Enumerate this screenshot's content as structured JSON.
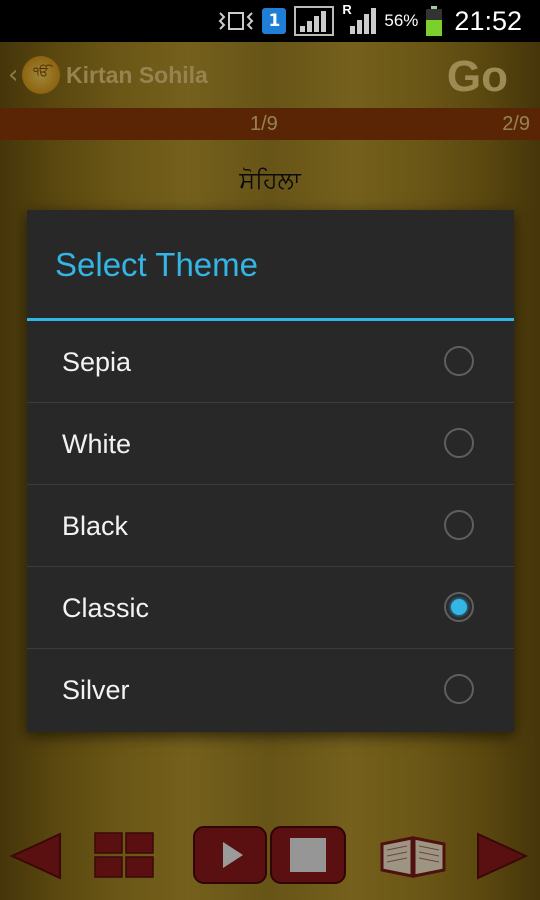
{
  "status_bar": {
    "sim_label": "1",
    "roaming": "R",
    "battery_percent": "56%",
    "time": "21:52",
    "icons": [
      "vibrate-icon",
      "sim-icon",
      "signal-icon",
      "roaming-signal-icon",
      "battery-icon"
    ]
  },
  "app": {
    "title": "Kirtan Sohila",
    "go_label": "Go",
    "page_current": "1/9",
    "page_next": "2/9",
    "heading": "ਸੋਹਿਲਾ"
  },
  "dialog": {
    "title": "Select Theme",
    "options": [
      {
        "label": "Sepia",
        "selected": false
      },
      {
        "label": "White",
        "selected": false
      },
      {
        "label": "Black",
        "selected": false
      },
      {
        "label": "Classic",
        "selected": true
      },
      {
        "label": "Silver",
        "selected": false
      }
    ]
  },
  "toolbar": {
    "icons": [
      "prev-arrow-icon",
      "grid-icon",
      "play-icon",
      "stop-icon",
      "book-icon",
      "next-arrow-icon"
    ]
  },
  "colors": {
    "accent": "#33b5e5",
    "dialog_bg": "#282828",
    "page_bar": "#8a3a08",
    "toolbar_red": "#8b1a1a"
  }
}
